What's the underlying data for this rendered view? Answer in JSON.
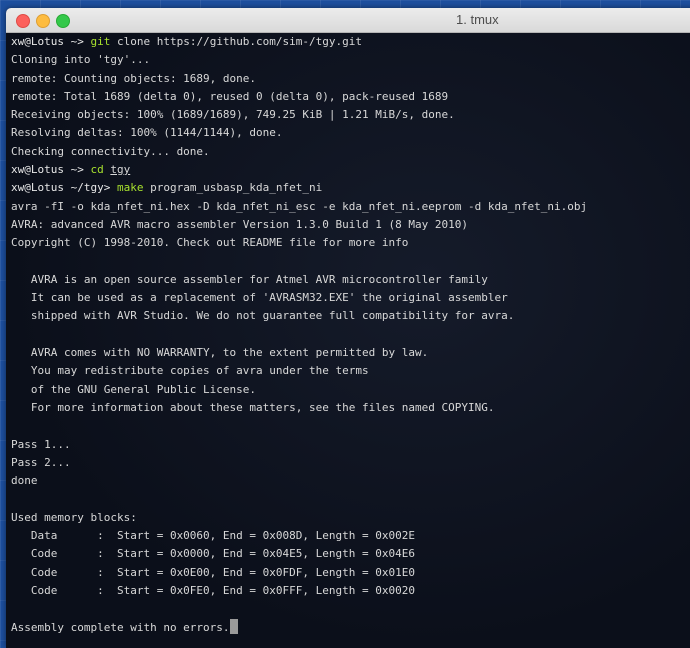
{
  "window": {
    "title": "1. tmux"
  },
  "terminal": {
    "lines": [
      {
        "prompt": "xw@Lotus ~>",
        "cmd": "git",
        "rest": " clone https://github.com/sim-/tgy.git"
      },
      {
        "text": "Cloning into 'tgy'..."
      },
      {
        "text": "remote: Counting objects: 1689, done."
      },
      {
        "text": "remote: Total 1689 (delta 0), reused 0 (delta 0), pack-reused 1689"
      },
      {
        "text": "Receiving objects: 100% (1689/1689), 749.25 KiB | 1.21 MiB/s, done."
      },
      {
        "text": "Resolving deltas: 100% (1144/1144), done."
      },
      {
        "text": "Checking connectivity... done."
      },
      {
        "prompt": "xw@Lotus ~>",
        "cmd": "cd",
        "arg": "tgy"
      },
      {
        "prompt": "xw@Lotus ~/tgy>",
        "cmd": "make",
        "rest": " program_usbasp_kda_nfet_ni"
      },
      {
        "text": "avra -fI -o kda_nfet_ni.hex -D kda_nfet_ni_esc -e kda_nfet_ni.eeprom -d kda_nfet_ni.obj"
      },
      {
        "text": "AVRA: advanced AVR macro assembler Version 1.3.0 Build 1 (8 May 2010)"
      },
      {
        "text": "Copyright (C) 1998-2010. Check out README file for more info"
      },
      {
        "text": ""
      },
      {
        "text": "   AVRA is an open source assembler for Atmel AVR microcontroller family"
      },
      {
        "text": "   It can be used as a replacement of 'AVRASM32.EXE' the original assembler"
      },
      {
        "text": "   shipped with AVR Studio. We do not guarantee full compatibility for avra."
      },
      {
        "text": ""
      },
      {
        "text": "   AVRA comes with NO WARRANTY, to the extent permitted by law."
      },
      {
        "text": "   You may redistribute copies of avra under the terms"
      },
      {
        "text": "   of the GNU General Public License."
      },
      {
        "text": "   For more information about these matters, see the files named COPYING."
      },
      {
        "text": ""
      },
      {
        "text": "Pass 1..."
      },
      {
        "text": "Pass 2..."
      },
      {
        "text": "done"
      },
      {
        "text": ""
      },
      {
        "text": "Used memory blocks:"
      },
      {
        "text": "   Data      :  Start = 0x0060, End = 0x008D, Length = 0x002E"
      },
      {
        "text": "   Code      :  Start = 0x0000, End = 0x04E5, Length = 0x04E6"
      },
      {
        "text": "   Code      :  Start = 0x0E00, End = 0x0FDF, Length = 0x01E0"
      },
      {
        "text": "   Code      :  Start = 0x0FE0, End = 0x0FFF, Length = 0x0020"
      },
      {
        "text": ""
      },
      {
        "text": "Assembly complete with no errors.",
        "cursor": true
      }
    ]
  }
}
